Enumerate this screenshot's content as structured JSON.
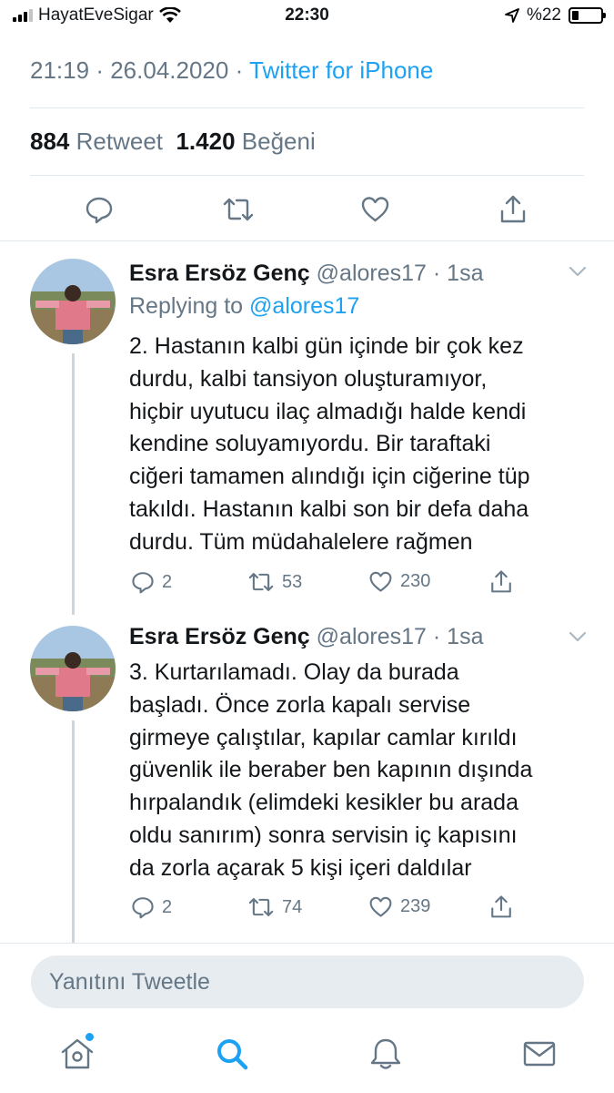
{
  "status_bar": {
    "carrier": "HayatEveSigar",
    "time": "22:30",
    "battery": "%22",
    "battery_level": 0.22
  },
  "tweet_meta": {
    "time": "21:19",
    "separator": "·",
    "date": "26.04.2020",
    "source": "Twitter for iPhone"
  },
  "stats": {
    "retweet_count": "884",
    "retweet_label": "Retweet",
    "like_count": "1.420",
    "like_label": "Beğeni"
  },
  "replies": [
    {
      "name": "Esra Ersöz Genç",
      "handle": "@alores17 · 1sa",
      "replying_label": "Replying to",
      "replying_to": "@alores17",
      "text": "2. Hastanın kalbi gün içinde bir çok kez\ndurdu, kalbi tansiyon oluşturamıyor,\nhiçbir uyutucu ilaç almadığı halde kendi\nkendine soluyamıyordu. Bir taraftaki\nciğeri tamamen alındığı için ciğerine tüp\ntakıldı. Hastanın  kalbi son bir defa daha\ndurdu. Tüm müdahalelere rağmen",
      "reply_count": "2",
      "retweet_count": "53",
      "like_count": "230"
    },
    {
      "name": "Esra Ersöz Genç",
      "handle": "@alores17 · 1sa",
      "text": "3. Kurtarılamadı. Olay da burada\nbaşladı. Önce zorla kapalı servise\ngirmeye çalıştılar, kapılar camlar kırıldı\ngüvenlik ile beraber ben kapının dışında\nhırpalandık (elimdeki kesikler bu arada\noldu sanırım) sonra servisin iç kapısını\nda zorla açarak 5 kişi içeri daldılar",
      "reply_count": "2",
      "retweet_count": "74",
      "like_count": "239"
    }
  ],
  "compose": {
    "placeholder": "Yanıtını Tweetle"
  },
  "tabbar": {
    "items": [
      "home-icon",
      "search-icon",
      "notifications-icon",
      "messages-icon"
    ],
    "active": "search-icon"
  },
  "colors": {
    "accent": "#1da1f2",
    "muted": "#657786",
    "text": "#14171a",
    "divider": "#e1e8ed"
  }
}
